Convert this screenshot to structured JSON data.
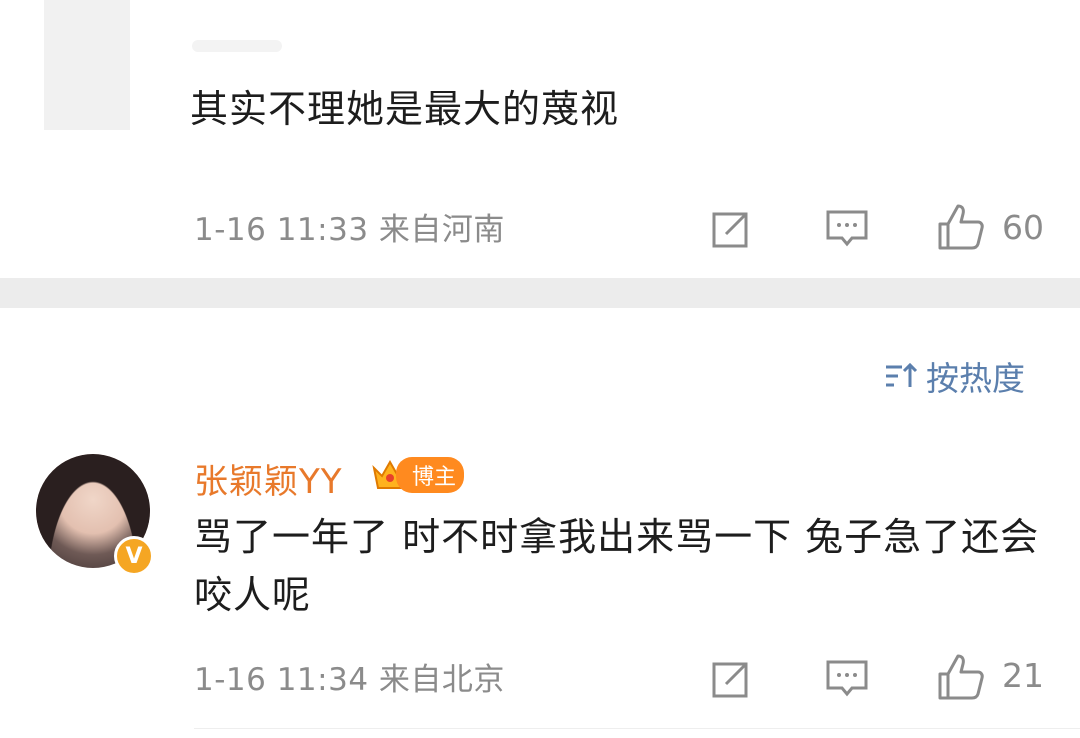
{
  "comments": [
    {
      "text": "其实不理她是最大的蔑视",
      "meta": "1-16 11:33 来自河南",
      "likes": "60"
    },
    {
      "username": "张颖颖YY",
      "badge": "博主",
      "verified_mark": "V",
      "text": "骂了一年了 时不时拿我出来骂一下 兔子急了还会咬人呢",
      "meta": "1-16 11:34 来自北京",
      "likes": "21"
    }
  ],
  "sort": {
    "label": "按热度"
  },
  "icons": {
    "share": "share-icon",
    "comment": "comment-icon",
    "like": "thumbs-up-icon",
    "sort": "sort-icon",
    "crown": "crown-icon"
  },
  "colors": {
    "username": "#e8792b",
    "sort_link": "#5b7fad",
    "meta_gray": "#8b8b8b",
    "badge_orange": "#ff8a1f",
    "divider": "#ececec"
  }
}
